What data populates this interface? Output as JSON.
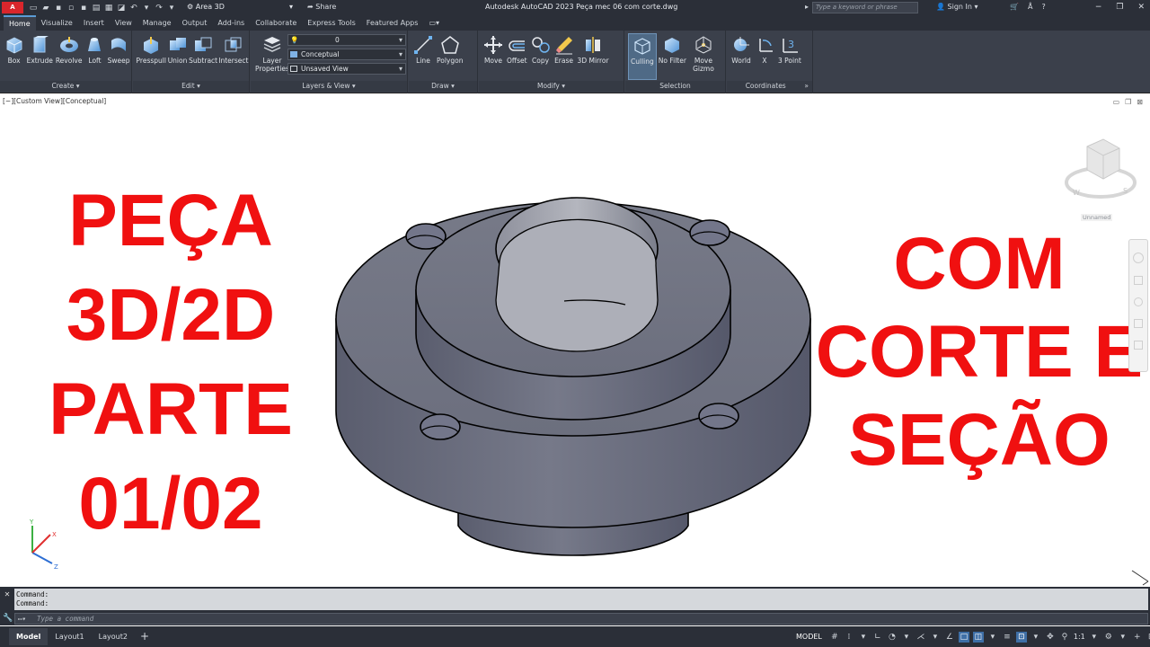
{
  "titlebar": {
    "logo": "A CAD",
    "workspace": "Area 3D",
    "share": "Share",
    "app_title": "Autodesk AutoCAD 2023    Peça mec 06 com corte.dwg",
    "search_placeholder": "Type a keyword or phrase",
    "signin": "Sign In"
  },
  "tabs": [
    "Home",
    "Visualize",
    "Insert",
    "View",
    "Manage",
    "Output",
    "Add-ins",
    "Collaborate",
    "Express Tools",
    "Featured Apps"
  ],
  "ribbon": {
    "create": {
      "title": "Create",
      "tools": [
        "Box",
        "Extrude",
        "Revolve",
        "Loft",
        "Sweep"
      ]
    },
    "edit": {
      "title": "Edit",
      "tools": [
        "Presspull",
        "Union",
        "Subtract",
        "Intersect"
      ]
    },
    "layers": {
      "title": "Layers & View",
      "tool": "Layer Properties",
      "layer": "0",
      "visual_style": "Conceptual",
      "view": "Unsaved View"
    },
    "draw": {
      "title": "Draw",
      "tools": [
        "Line",
        "Polygon"
      ]
    },
    "modify": {
      "title": "Modify",
      "tools": [
        "Move",
        "Offset",
        "Copy",
        "Erase",
        "3D Mirror"
      ]
    },
    "selection": {
      "title": "Selection",
      "tools": [
        "Culling",
        "No Filter",
        "Move Gizmo"
      ]
    },
    "coordinates": {
      "title": "Coordinates",
      "tools": [
        "World",
        "X",
        "3 Point"
      ]
    }
  },
  "viewport": {
    "label": "[−][Custom View][Conceptual]",
    "left_text": [
      "PEÇA",
      "3D/2D",
      "PARTE",
      "01/02"
    ],
    "right_text": [
      "COM",
      "CORTE E",
      "SEÇÃO"
    ],
    "viewcube_caption": "Unnamed"
  },
  "colors": {
    "overlay_text": "#f01010",
    "part_face": "#6e7183",
    "ui_dark": "#2b2f38"
  },
  "command": {
    "history": [
      "Command:",
      "Command:"
    ],
    "placeholder": "Type a command"
  },
  "status": {
    "layout_tabs": [
      "Model",
      "Layout1",
      "Layout2"
    ],
    "space": "MODEL",
    "scale": "1:1"
  }
}
